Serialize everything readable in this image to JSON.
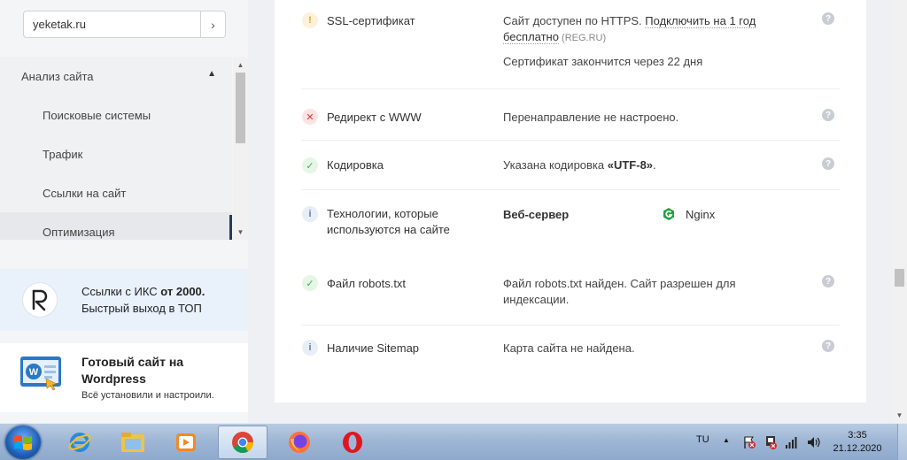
{
  "sidebar": {
    "domain": "yeketak.ru",
    "domain_go": "›",
    "section": "Анализ сайта",
    "items": [
      {
        "label": "Поисковые системы"
      },
      {
        "label": "Трафик"
      },
      {
        "label": "Ссылки на сайт"
      },
      {
        "label": "Оптимизация"
      }
    ]
  },
  "promo1": {
    "line1_pre": "Ссылки с ИКС ",
    "line1_bold": "от 2000.",
    "line2": "Быстрый выход в ТОП"
  },
  "promo2": {
    "title": "Готовый сайт на Wordpress",
    "subtitle": "Всё установили и настроили."
  },
  "rows": [
    {
      "status": "!",
      "label": "SSL-сертификат",
      "value_pre": "Сайт доступен по HTTPS. ",
      "value_link": "Подключить на 1 год бесплатно",
      "value_small": " (REG.RU)",
      "value2": "Сертификат закончится через 22 дня"
    },
    {
      "status": "✕",
      "label": "Редирект с WWW",
      "value": "Перенаправление не настроено."
    },
    {
      "status": "✓",
      "label": "Кодировка",
      "value_pre": "Указана кодировка ",
      "value_bold": "«UTF-8»",
      "value_post": "."
    },
    {
      "status": "i",
      "label": "Технологии, которые используются на сайте",
      "tech_name": "Веб-сервер",
      "tech_value": "Nginx"
    },
    {
      "status": "✓",
      "label": "Файл robots.txt",
      "value": "Файл robots.txt найден. Сайт разрешен для индексации."
    },
    {
      "status": "i",
      "label": "Наличие Sitemap",
      "value": "Карта сайта не найдена."
    }
  ],
  "help": "?",
  "taskbar": {
    "lang": "TU",
    "time": "3:35",
    "date": "21.12.2020"
  },
  "colors": {
    "warn": "#e8a019",
    "error": "#e0393e",
    "ok": "#3fb34f",
    "info": "#6a7d9a"
  }
}
